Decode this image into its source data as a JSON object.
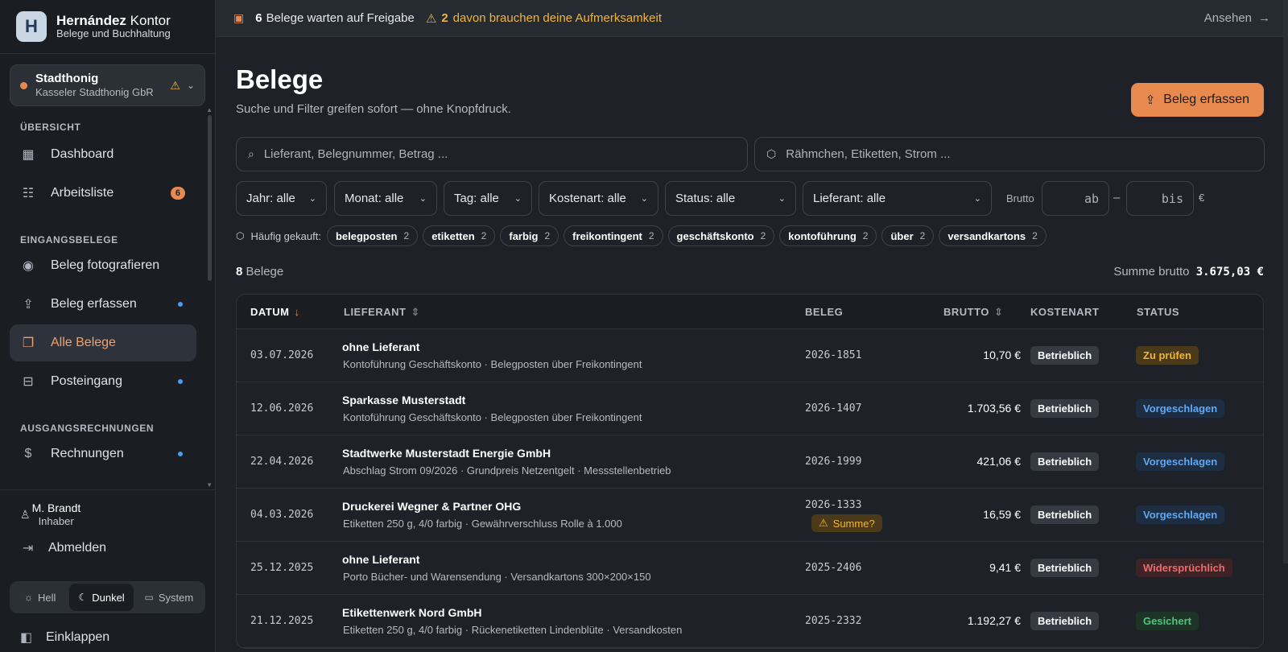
{
  "brand": {
    "name_bold": "Hernández",
    "name_rest": " Kontor",
    "subtitle": "Belege und Buchhaltung",
    "logo_letter": "H"
  },
  "org": {
    "name": "Stadthonig",
    "company": "Kasseler Stadthonig GbR"
  },
  "nav": {
    "sections": [
      {
        "label": "ÜBERSICHT"
      },
      {
        "label": "EINGANGSBELEGE"
      },
      {
        "label": "AUSGANGSRECHNUNGEN"
      }
    ],
    "items": [
      {
        "label": "Dashboard",
        "icon": "dashboard-icon"
      },
      {
        "label": "Arbeitsliste",
        "icon": "checklist-icon",
        "badge": "6"
      },
      {
        "label": "Beleg fotografieren",
        "icon": "camera-icon"
      },
      {
        "label": "Beleg erfassen",
        "icon": "upload-icon"
      },
      {
        "label": "Alle Belege",
        "icon": "documents-icon"
      },
      {
        "label": "Posteingang",
        "icon": "inbox-icon"
      },
      {
        "label": "Rechnungen",
        "icon": "invoice-icon"
      }
    ]
  },
  "user": {
    "name": "M. Brandt",
    "role": "Inhaber",
    "logout": "Abmelden"
  },
  "theme": {
    "light": "Hell",
    "dark": "Dunkel",
    "system": "System"
  },
  "collapse": "Einklappen",
  "banner": {
    "count": "6",
    "text": "Belege warten auf Freigabe",
    "warn_count": "2",
    "warn_text": "davon brauchen deine Aufmerksamkeit",
    "action": "Ansehen"
  },
  "page": {
    "title": "Belege",
    "subtitle": "Suche und Filter greifen sofort — ohne Knopfdruck.",
    "primary_button": "Beleg erfassen"
  },
  "search": {
    "main_placeholder": "Lieferant, Belegnummer, Betrag ...",
    "item_placeholder": "Rähmchen, Etiketten, Strom ..."
  },
  "filters": {
    "jahr": "Jahr: alle",
    "monat": "Monat: alle",
    "tag": "Tag: alle",
    "kostenart": "Kostenart: alle",
    "status": "Status: alle",
    "lieferant": "Lieferant: alle",
    "brutto_label": "Brutto",
    "from_placeholder": "ab",
    "to_placeholder": "bis",
    "dash": "–",
    "currency": "€"
  },
  "tags": {
    "label": "Häufig gekauft:",
    "items": [
      {
        "name": "belegposten",
        "count": "2"
      },
      {
        "name": "etiketten",
        "count": "2"
      },
      {
        "name": "farbig",
        "count": "2"
      },
      {
        "name": "freikontingent",
        "count": "2"
      },
      {
        "name": "geschäftskonto",
        "count": "2"
      },
      {
        "name": "kontoführung",
        "count": "2"
      },
      {
        "name": "über",
        "count": "2"
      },
      {
        "name": "versandkartons",
        "count": "2"
      }
    ]
  },
  "summary": {
    "count": "8",
    "count_label": "Belege",
    "sum_label": "Summe brutto",
    "sum_value": "3.675,03 €"
  },
  "table": {
    "headers": {
      "datum": "DATUM",
      "lieferant": "LIEFERANT",
      "beleg": "BELEG",
      "brutto": "BRUTTO",
      "kostenart": "KOSTENART",
      "status": "STATUS"
    },
    "rows": [
      {
        "date": "03.07.2026",
        "supplier": "ohne Lieferant",
        "desc": "Kontoführung Geschäftskonto · Belegposten über Freikontingent",
        "beleg": "2026-1851",
        "brutto": "10,70 €",
        "kostenart": "Betrieblich",
        "status": "Zu prüfen",
        "status_color": "#f0b537",
        "status_bg": "#4a3a1a"
      },
      {
        "date": "12.06.2026",
        "supplier": "Sparkasse Musterstadt",
        "desc": "Kontoführung Geschäftskonto · Belegposten über Freikontingent",
        "beleg": "2026-1407",
        "brutto": "1.703,56 €",
        "kostenart": "Betrieblich",
        "status": "Vorgeschlagen",
        "status_color": "#5fa8f5",
        "status_bg": "#1d2d42"
      },
      {
        "date": "22.04.2026",
        "supplier": "Stadtwerke Musterstadt Energie GmbH",
        "desc": "Abschlag Strom 09/2026 · Grundpreis Netzentgelt · Messstellenbetrieb",
        "beleg": "2026-1999",
        "brutto": "421,06 €",
        "kostenart": "Betrieblich",
        "status": "Vorgeschlagen",
        "status_color": "#5fa8f5",
        "status_bg": "#1d2d42"
      },
      {
        "date": "04.03.2026",
        "supplier": "Druckerei Wegner & Partner OHG",
        "desc": "Etiketten 250 g, 4/0 farbig · Gewährverschluss Rolle à 1.000",
        "beleg": "2026-1333",
        "warn": "Summe?",
        "brutto": "16,59 €",
        "kostenart": "Betrieblich",
        "status": "Vorgeschlagen",
        "status_color": "#5fa8f5",
        "status_bg": "#1d2d42"
      },
      {
        "date": "25.12.2025",
        "supplier": "ohne Lieferant",
        "desc": "Porto Bücher- und Warensendung · Versandkartons 300×200×150",
        "beleg": "2025-2406",
        "brutto": "9,41 €",
        "kostenart": "Betrieblich",
        "status": "Widersprüchlich",
        "status_color": "#ef6a6a",
        "status_bg": "#3d2326"
      },
      {
        "date": "21.12.2025",
        "supplier": "Etikettenwerk Nord GmbH",
        "desc": "Etiketten 250 g, 4/0 farbig · Rückenetiketten Lindenblüte · Versandkosten",
        "beleg": "2025-2332",
        "brutto": "1.192,27 €",
        "kostenart": "Betrieblich",
        "status": "Gesichert",
        "status_color": "#4fc47a",
        "status_bg": "#1d3527"
      }
    ]
  },
  "colors": {
    "accent": "#e8894d",
    "warning": "#f0b537",
    "info": "#4b9cf0"
  }
}
